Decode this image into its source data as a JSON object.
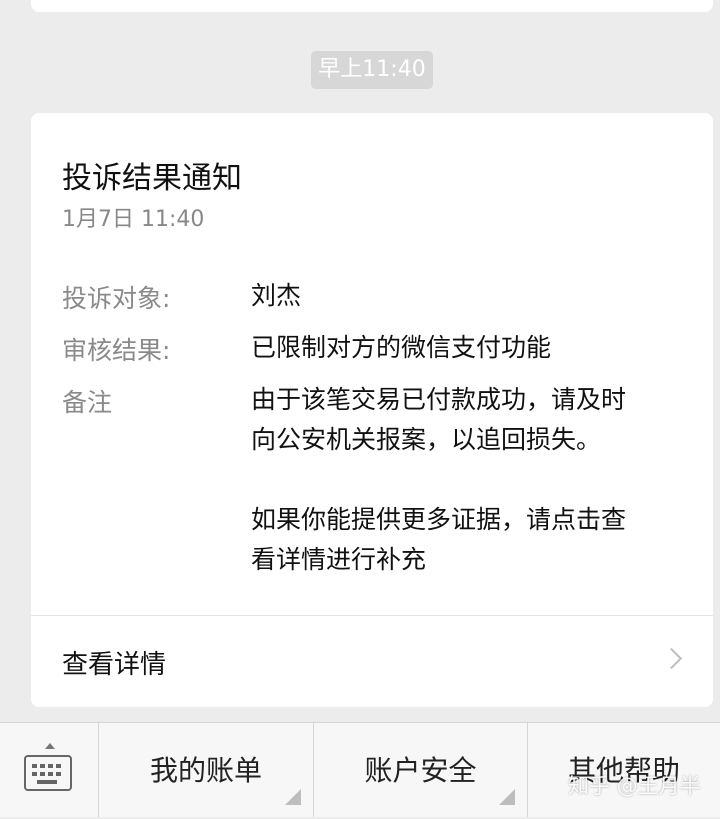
{
  "timestamp": "早上11:40",
  "card": {
    "title": "投诉结果通知",
    "date": "1月7日  11:40",
    "fields": [
      {
        "label": "投诉对象:",
        "value": "刘杰"
      },
      {
        "label": "审核结果:",
        "value": "已限制对方的微信支付功能"
      },
      {
        "label": "备注",
        "value_lines": [
          "由于该笔交易已付款成功，请及时",
          "向公安机关报案，以追回损失。",
          "",
          "如果你能提供更多证据，请点击查",
          "看详情进行补充"
        ]
      }
    ],
    "detail_link": "查看详情"
  },
  "menu": {
    "keyboard_icon": "keyboard-icon",
    "items": [
      "我的账单",
      "账户安全",
      "其他帮助"
    ]
  },
  "watermark": "知乎 @王月半"
}
